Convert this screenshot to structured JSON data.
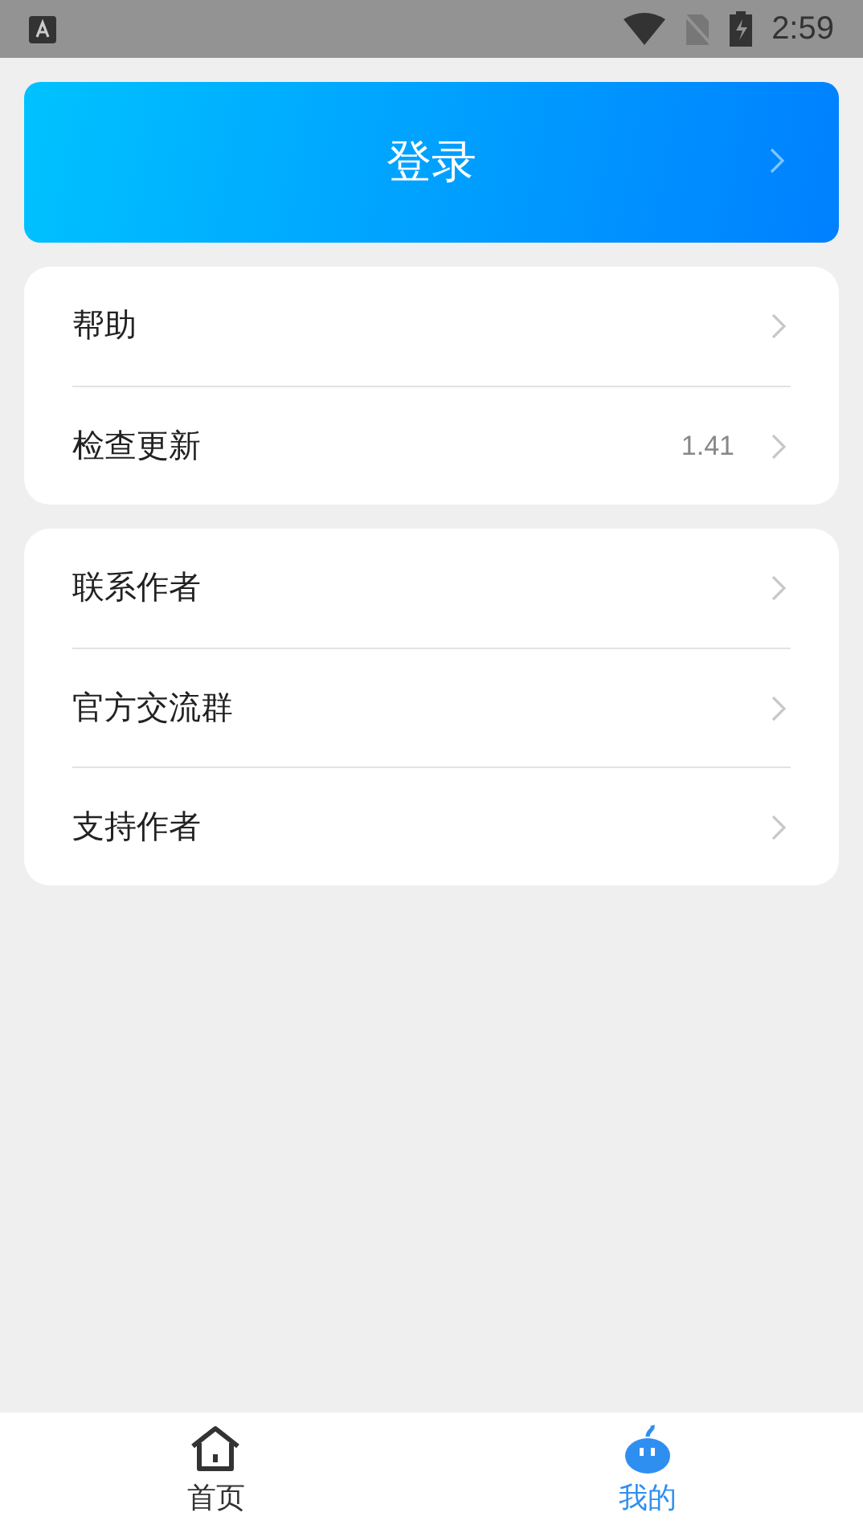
{
  "status_bar": {
    "time": "2:59"
  },
  "login": {
    "label": "登录"
  },
  "groups": [
    {
      "items": [
        {
          "label": "帮助"
        },
        {
          "label": "检查更新",
          "value": "1.41"
        }
      ]
    },
    {
      "items": [
        {
          "label": "联系作者"
        },
        {
          "label": "官方交流群"
        },
        {
          "label": "支持作者"
        }
      ]
    }
  ],
  "tabs": [
    {
      "label": "首页",
      "kind": "home",
      "selected": false
    },
    {
      "label": "我的",
      "kind": "mascot",
      "selected": true
    }
  ]
}
